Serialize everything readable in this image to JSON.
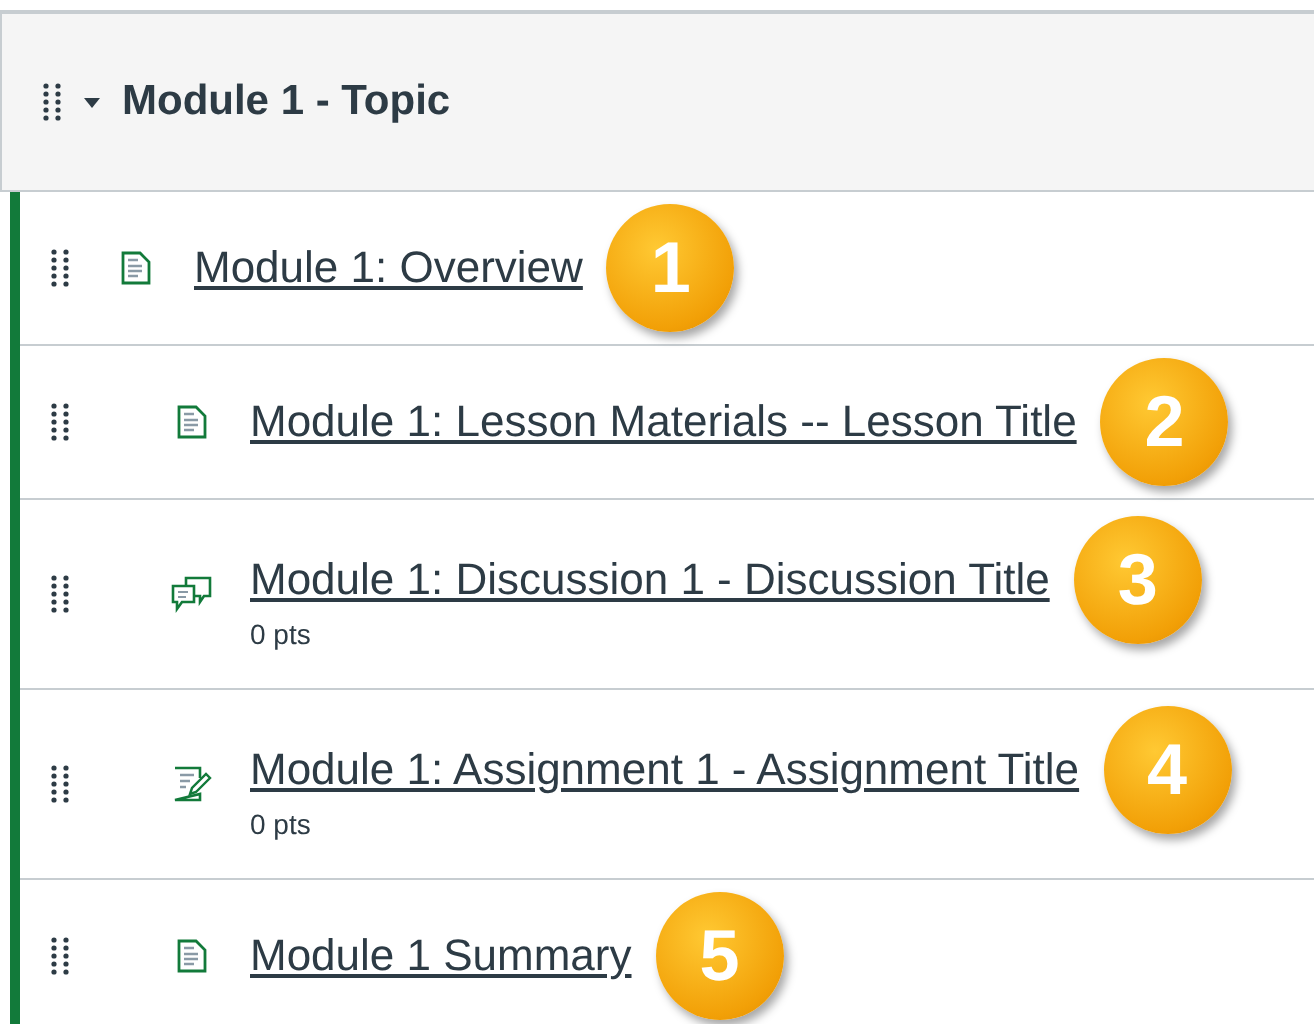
{
  "module": {
    "title": "Module 1 - Topic",
    "expanded": true
  },
  "items": [
    {
      "kind": "page",
      "title": "Module 1: Overview",
      "badge": "1",
      "children": [
        {
          "kind": "page",
          "title": "Module 1: Lesson Materials -- Lesson Title",
          "badge": "2"
        },
        {
          "kind": "discussion",
          "title": "Module 1: Discussion 1 - Discussion Title",
          "points": "0 pts",
          "badge": "3"
        },
        {
          "kind": "assignment",
          "title": "Module 1: Assignment 1 - Assignment Title",
          "points": "0 pts",
          "badge": "4"
        },
        {
          "kind": "page",
          "title": "Module 1 Summary",
          "badge": "5"
        }
      ]
    }
  ]
}
